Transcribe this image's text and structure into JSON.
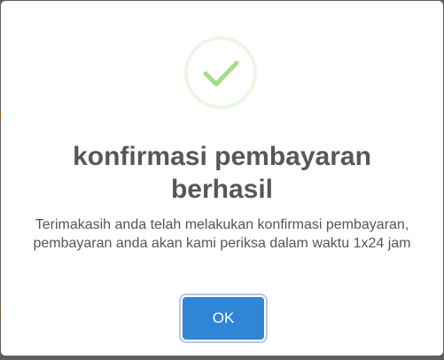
{
  "background": {
    "partial_text": "........ .. ....... . ........"
  },
  "dialog": {
    "icon": "success-check-icon",
    "icon_color": "#a5dc86",
    "title": "konfirmasi pembayaran berhasil",
    "message": "Terimakasih anda telah melakukan konfirmasi pembayaran, pembayaran anda akan kami periksa dalam waktu 1x24 jam",
    "ok_label": "OK",
    "ok_color": "#3085d6"
  }
}
